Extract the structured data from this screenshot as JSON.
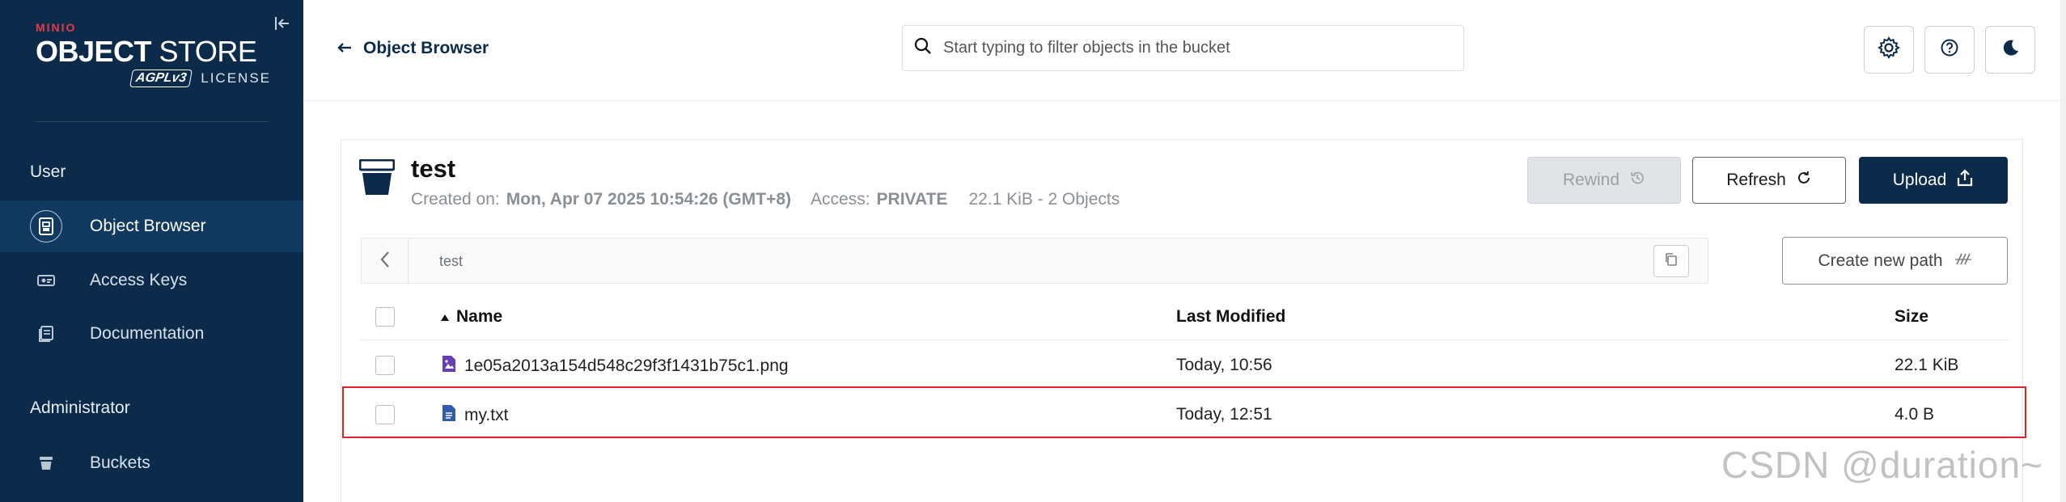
{
  "sidebar": {
    "brand_small": "MINIO",
    "brand_title_bold": "OBJECT",
    "brand_title_rest": " STORE",
    "brand_agpl": "AGPLv3",
    "brand_license": "LICENSE",
    "user_section": "User",
    "admin_section": "Administrator",
    "items": [
      {
        "label": "Object Browser",
        "icon": "object-browser-icon",
        "active": true
      },
      {
        "label": "Access Keys",
        "icon": "access-keys-icon",
        "active": false
      },
      {
        "label": "Documentation",
        "icon": "documentation-icon",
        "active": false
      }
    ],
    "admin_items": [
      {
        "label": "Buckets",
        "icon": "bucket-icon"
      }
    ]
  },
  "header": {
    "back_label": "Object Browser",
    "search_placeholder": "Start typing to filter objects in the bucket",
    "buttons": [
      "settings-icon",
      "help-icon",
      "dark-mode-icon"
    ]
  },
  "bucket": {
    "name": "test",
    "created_label": "Created on:",
    "created_value": "Mon, Apr 07 2025 10:54:26 (GMT+8)",
    "access_label": "Access:",
    "access_value": "PRIVATE",
    "size_summary": "22.1 KiB - 2 Objects",
    "rewind_label": "Rewind",
    "refresh_label": "Refresh",
    "upload_label": "Upload"
  },
  "path": {
    "current": "test",
    "new_path_label": "Create new path"
  },
  "table": {
    "columns": [
      "Name",
      "Last Modified",
      "Size"
    ],
    "rows": [
      {
        "name": "1e05a2013a154d548c29f3f1431b75c1.png",
        "type": "image",
        "modified": "Today, 10:56",
        "size": "22.1 KiB"
      },
      {
        "name": "my.txt",
        "type": "text",
        "modified": "Today, 12:51",
        "size": "4.0 B"
      }
    ]
  },
  "watermark": "CSDN @duration~",
  "colors": {
    "sidebar_bg": "#0c2a4a",
    "accent": "#0c2a4a",
    "highlight": "#e2222a",
    "brand_red": "#e33b4b"
  }
}
